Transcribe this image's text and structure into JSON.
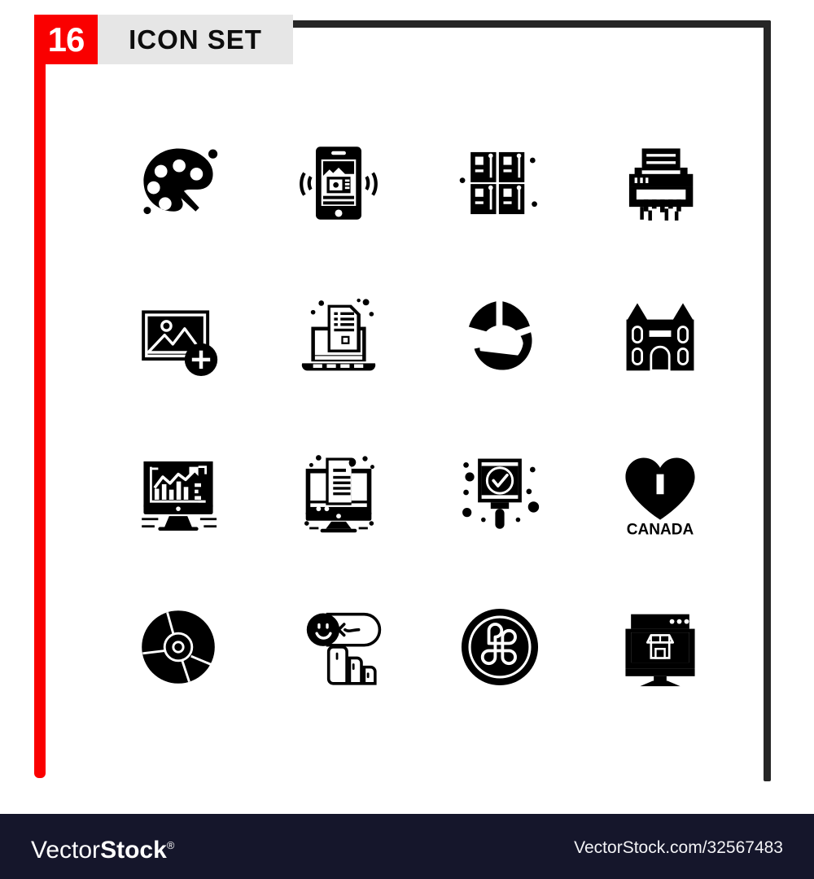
{
  "header": {
    "count_label": "16",
    "title": "ICON SET"
  },
  "colors": {
    "accent_red": "#fa0000",
    "frame_dark": "#262626",
    "badge_gray": "#e6e6e6",
    "footer_navy": "#15162b",
    "icon_black": "#000000",
    "page_white": "#ffffff"
  },
  "grid": {
    "rows": 4,
    "columns": 4,
    "total": 16,
    "icons": [
      {
        "position": 1,
        "name": "paint-palette-icon",
        "label": "paint palette with brush"
      },
      {
        "position": 2,
        "name": "mobile-media-icon",
        "label": "smartphone media vibrate"
      },
      {
        "position": 3,
        "name": "lockers-icon",
        "label": "storage lockers"
      },
      {
        "position": 4,
        "name": "paper-shredder-icon",
        "label": "paper shredder"
      },
      {
        "position": 5,
        "name": "add-image-icon",
        "label": "add picture"
      },
      {
        "position": 6,
        "name": "laptop-document-icon",
        "label": "laptop with document"
      },
      {
        "position": 7,
        "name": "pie-chart-icon",
        "label": "pie chart"
      },
      {
        "position": 8,
        "name": "castle-icon",
        "label": "castle building"
      },
      {
        "position": 9,
        "name": "monitor-analytics-icon",
        "label": "monitor analytics chart"
      },
      {
        "position": 10,
        "name": "monitor-document-icon",
        "label": "monitor with document"
      },
      {
        "position": 11,
        "name": "approved-sign-icon",
        "label": "approved checkmark sign"
      },
      {
        "position": 12,
        "name": "canada-heart-icon",
        "label": "Canada heart"
      },
      {
        "position": 13,
        "name": "compact-disc-icon",
        "label": "compact disc"
      },
      {
        "position": 14,
        "name": "emoji-feedback-swipe-icon",
        "label": "emoji swipe feedback"
      },
      {
        "position": 15,
        "name": "command-key-icon",
        "label": "command key button"
      },
      {
        "position": 16,
        "name": "online-store-icon",
        "label": "online store on monitor"
      }
    ]
  },
  "icon_text": {
    "canada": "CANADA"
  },
  "footer": {
    "brand_light": "Vector",
    "brand_bold": "Stock",
    "brand_reg": "®",
    "url": "VectorStock.com/32567483"
  }
}
